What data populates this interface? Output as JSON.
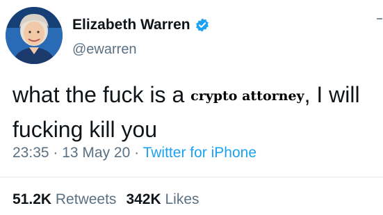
{
  "author": {
    "display_name": "Elizabeth Warren",
    "handle": "@ewarren",
    "verified": true,
    "avatar_icon": "profile-photo"
  },
  "tweet": {
    "text_before": "what the fuck is a ",
    "overlay_text": "crypto attorney",
    "text_after": ", I will fucking kill you"
  },
  "meta": {
    "time": "23:35",
    "separator": " · ",
    "date": "13 May 20",
    "source": "Twitter for iPhone"
  },
  "stats": {
    "retweets_count": "51.2K",
    "retweets_label": "Retweets",
    "likes_count": "342K",
    "likes_label": "Likes"
  },
  "colors": {
    "text": "#0f1419",
    "secondary": "#5b7083",
    "accent": "#1da1f2",
    "divider": "#e1e8ed"
  }
}
